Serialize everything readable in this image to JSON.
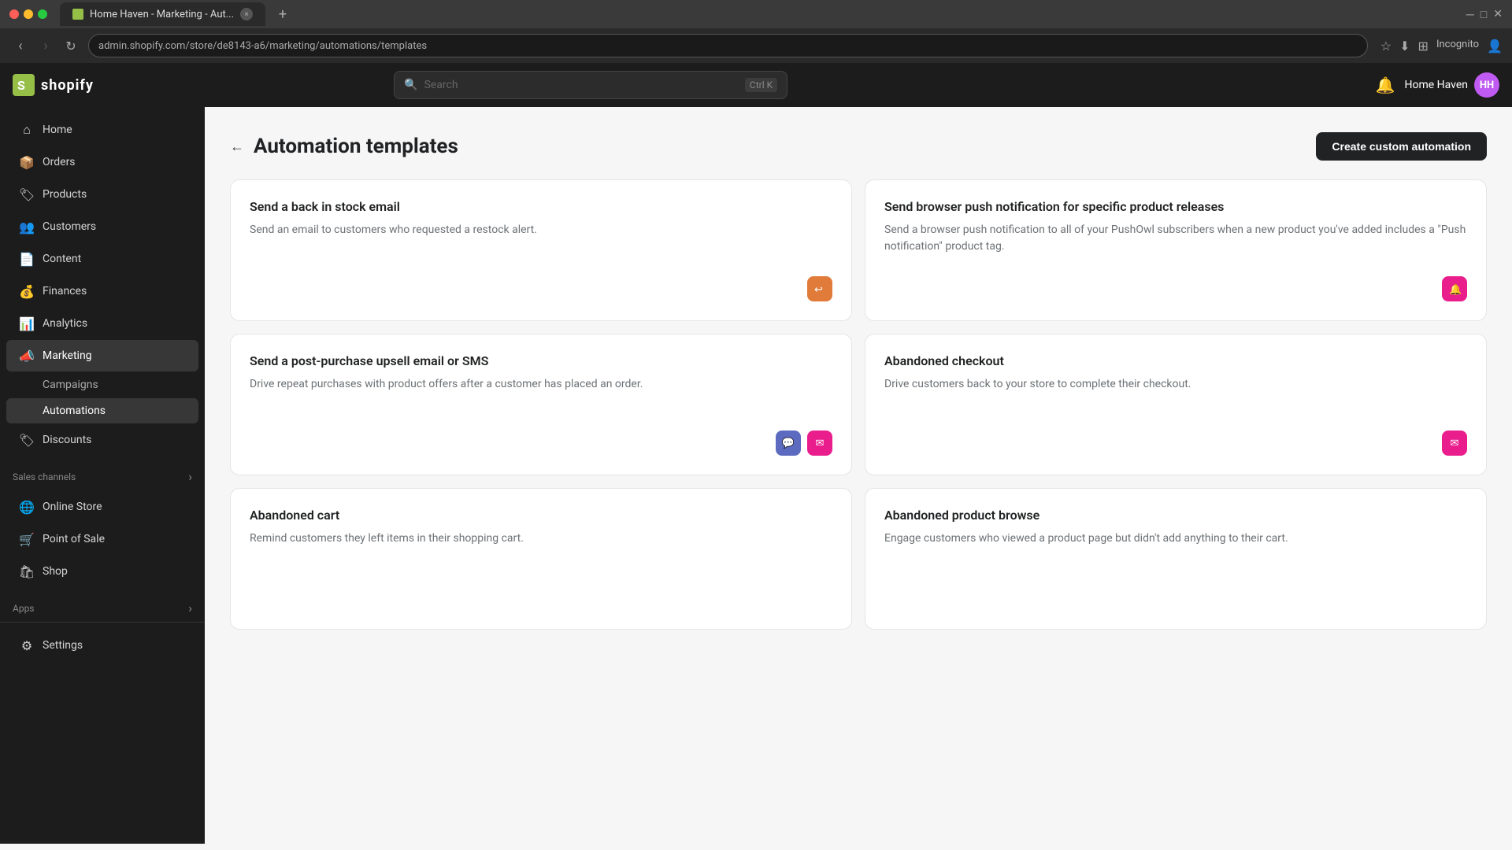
{
  "browser": {
    "tab_title": "Home Haven - Marketing - Aut...",
    "url": "admin.shopify.com/store/de8143-a6/marketing/automations/templates",
    "new_tab_label": "+"
  },
  "header": {
    "logo_text": "shopify",
    "search_placeholder": "Search",
    "search_shortcut": "Ctrl K",
    "store_name": "Home Haven",
    "avatar_initials": "HH"
  },
  "sidebar": {
    "items": [
      {
        "id": "home",
        "label": "Home",
        "icon": "⌂"
      },
      {
        "id": "orders",
        "label": "Orders",
        "icon": "📦"
      },
      {
        "id": "products",
        "label": "Products",
        "icon": "🏷"
      },
      {
        "id": "customers",
        "label": "Customers",
        "icon": "👥"
      },
      {
        "id": "content",
        "label": "Content",
        "icon": "📄"
      },
      {
        "id": "finances",
        "label": "Finances",
        "icon": "💰"
      },
      {
        "id": "analytics",
        "label": "Analytics",
        "icon": "📊"
      },
      {
        "id": "marketing",
        "label": "Marketing",
        "icon": "📣"
      },
      {
        "id": "discounts",
        "label": "Discounts",
        "icon": "🏷"
      }
    ],
    "marketing_subitems": [
      {
        "id": "campaigns",
        "label": "Campaigns"
      },
      {
        "id": "automations",
        "label": "Automations",
        "active": true
      }
    ],
    "sales_channels_label": "Sales channels",
    "sales_channels": [
      {
        "id": "online-store",
        "label": "Online Store",
        "icon": "🌐"
      },
      {
        "id": "point-of-sale",
        "label": "Point of Sale",
        "icon": "🛒"
      },
      {
        "id": "shop",
        "label": "Shop",
        "icon": "🛍"
      }
    ],
    "apps_label": "Apps",
    "settings_label": "Settings"
  },
  "page": {
    "title": "Automation templates",
    "back_label": "←",
    "create_button_label": "Create custom automation"
  },
  "cards": [
    {
      "id": "back-in-stock",
      "title": "Send a back in stock email",
      "description": "Send an email to customers who requested a restock alert.",
      "icons": [
        "orange-restock"
      ]
    },
    {
      "id": "browser-push",
      "title": "Send browser push notification for specific product releases",
      "description": "Send a browser push notification to all of your PushOwl subscribers when a new product you've added includes a \"Push notification\" product tag.",
      "icons": [
        "pink-push"
      ]
    },
    {
      "id": "post-purchase",
      "title": "Send a post-purchase upsell email or SMS",
      "description": "Drive repeat purchases with product offers after a customer has placed an order.",
      "icons": [
        "sms-icon",
        "email-icon"
      ]
    },
    {
      "id": "abandoned-checkout",
      "title": "Abandoned checkout",
      "description": "Drive customers back to your store to complete their checkout.",
      "icons": [
        "email-icon"
      ]
    },
    {
      "id": "abandoned-cart",
      "title": "Abandoned cart",
      "description": "Remind customers they left items in their shopping cart.",
      "icons": []
    },
    {
      "id": "abandoned-browse",
      "title": "Abandoned product browse",
      "description": "Engage customers who viewed a product page but didn't add anything to their cart.",
      "icons": []
    }
  ]
}
